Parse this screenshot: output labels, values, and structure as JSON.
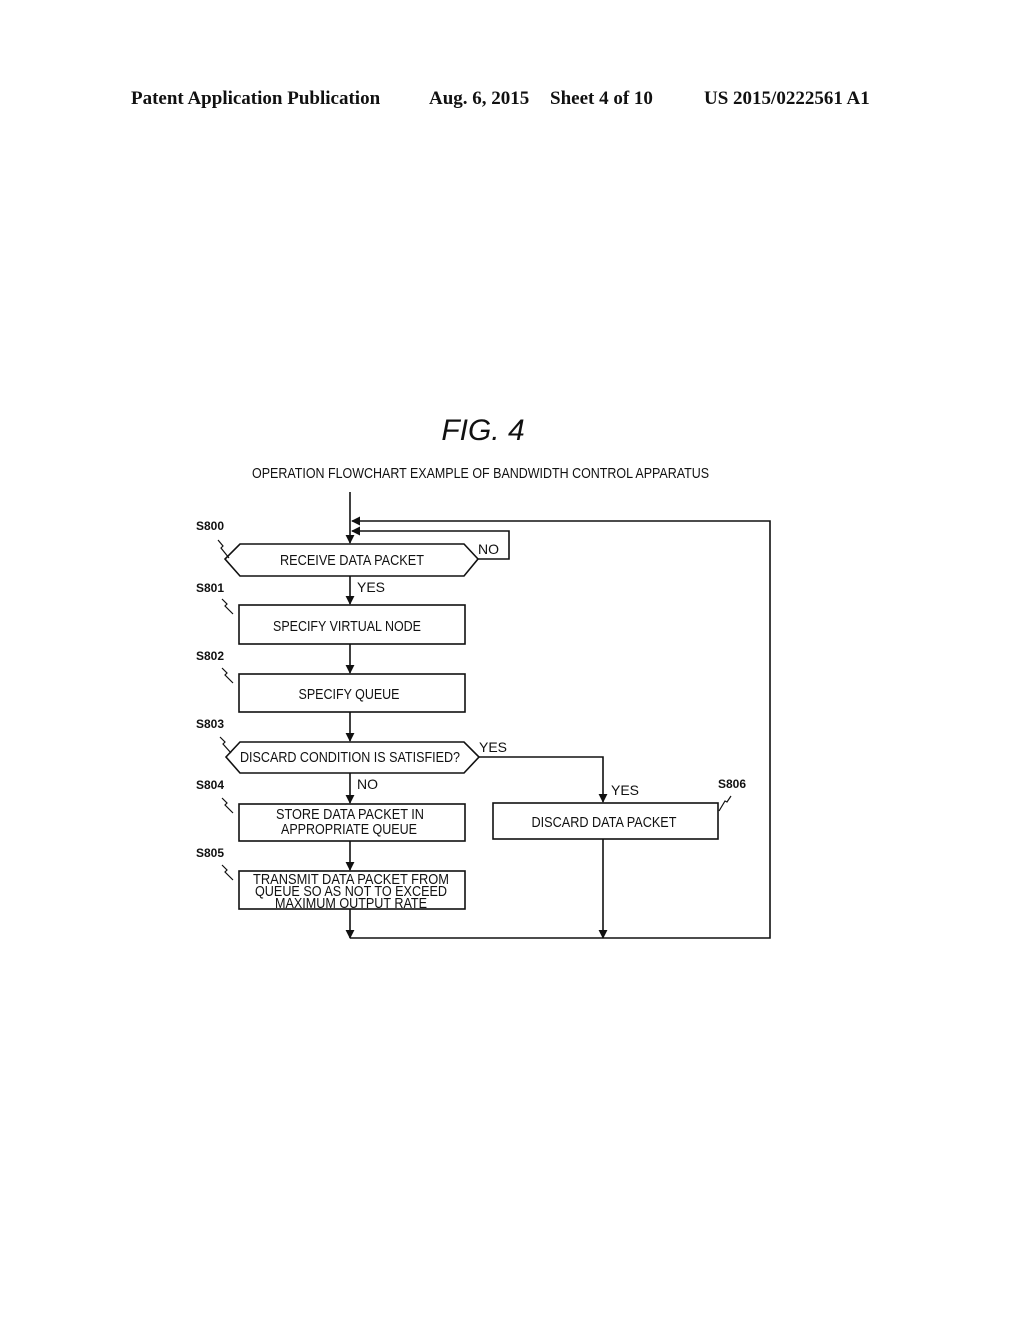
{
  "header": {
    "publication": "Patent Application Publication",
    "date": "Aug. 6, 2015",
    "sheet": "Sheet 4 of 10",
    "number": "US 2015/0222561 A1"
  },
  "figure": {
    "title": "FIG. 4",
    "caption": "OPERATION FLOWCHART EXAMPLE OF BANDWIDTH CONTROL APPARATUS"
  },
  "flowchart": {
    "steps": [
      {
        "id": "S800",
        "shape": "decision",
        "lines": [
          "RECEIVE DATA PACKET"
        ]
      },
      {
        "id": "S801",
        "shape": "process",
        "lines": [
          "SPECIFY VIRTUAL NODE"
        ]
      },
      {
        "id": "S802",
        "shape": "process",
        "lines": [
          "SPECIFY QUEUE"
        ]
      },
      {
        "id": "S803",
        "shape": "decision",
        "lines": [
          "DISCARD CONDITION IS SATISFIED?"
        ]
      },
      {
        "id": "S804",
        "shape": "process",
        "lines": [
          "STORE DATA PACKET IN",
          "APPROPRIATE QUEUE"
        ]
      },
      {
        "id": "S805",
        "shape": "process",
        "lines": [
          "TRANSMIT DATA PACKET FROM",
          "QUEUE SO AS NOT TO EXCEED",
          "MAXIMUM OUTPUT RATE"
        ]
      },
      {
        "id": "S806",
        "shape": "process",
        "lines": [
          "DISCARD DATA PACKET"
        ]
      }
    ],
    "edge_labels": {
      "s800_no": "NO",
      "s800_yes": "YES",
      "s803_yes": "YES",
      "s803_no": "NO",
      "s806_yes": "YES"
    }
  }
}
